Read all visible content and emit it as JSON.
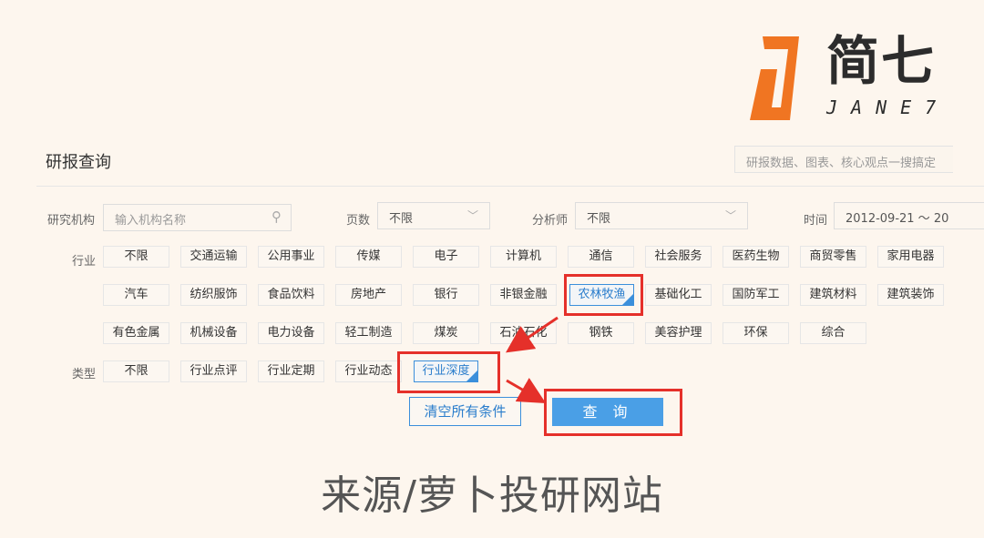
{
  "logo": {
    "text": "简七",
    "sub": "JANE7"
  },
  "header": {
    "title": "研报查询",
    "search_placeholder": "研报数据、图表、核心观点一搜搞定"
  },
  "filters": {
    "org_label": "研究机构",
    "org_placeholder": "输入机构名称",
    "pages_label": "页数",
    "pages_value": "不限",
    "analyst_label": "分析师",
    "analyst_value": "不限",
    "time_label": "时间",
    "time_value": "2012-09-21 ～ 20"
  },
  "industry": {
    "label": "行业",
    "row1": [
      "不限",
      "交通运输",
      "公用事业",
      "传媒",
      "电子",
      "计算机",
      "通信",
      "社会服务",
      "医药生物",
      "商贸零售",
      "家用电器"
    ],
    "row2": [
      "汽车",
      "纺织服饰",
      "食品饮料",
      "房地产",
      "银行",
      "非银金融",
      "农林牧渔",
      "基础化工",
      "国防军工",
      "建筑材料",
      "建筑装饰"
    ],
    "row3": [
      "有色金属",
      "机械设备",
      "电力设备",
      "轻工制造",
      "煤炭",
      "石油石化",
      "钢铁",
      "美容护理",
      "环保",
      "综合"
    ]
  },
  "type": {
    "label": "类型",
    "items": [
      "不限",
      "行业点评",
      "行业定期",
      "行业动态",
      "行业深度"
    ]
  },
  "actions": {
    "clear": "清空所有条件",
    "query": "查 询"
  },
  "footer": {
    "source": "来源/萝卜投研网站"
  },
  "colors": {
    "accent": "#3b8fdb",
    "highlight": "#e5302a",
    "logo_orange": "#f07522"
  }
}
